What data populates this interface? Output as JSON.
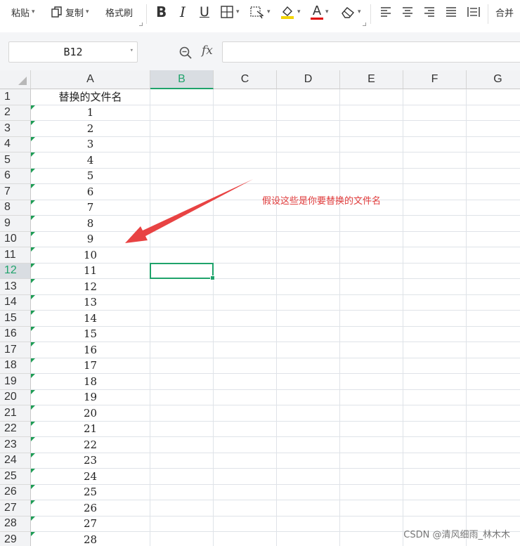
{
  "toolbar": {
    "paste_label": "粘贴",
    "copy_label": "复制",
    "format_painter_label": "格式刷",
    "bold_glyph": "B",
    "italic_glyph": "I",
    "underline_glyph": "U",
    "font_color_glyph": "A",
    "merge_label": "合并"
  },
  "formula_bar": {
    "name_box": "B12",
    "fx_label": "fx",
    "formula": ""
  },
  "sheet": {
    "columns": [
      "A",
      "B",
      "C",
      "D",
      "E",
      "F",
      "G"
    ],
    "rows": [
      "1",
      "2",
      "3",
      "4",
      "5",
      "6",
      "7",
      "8",
      "9",
      "10",
      "11",
      "12",
      "13",
      "14",
      "15",
      "16",
      "17",
      "18",
      "19",
      "20",
      "21",
      "22",
      "23",
      "24",
      "25",
      "26",
      "27",
      "28",
      "29"
    ],
    "column_a_values": [
      "替换的文件名",
      "1",
      "2",
      "3",
      "4",
      "5",
      "6",
      "7",
      "8",
      "9",
      "10",
      "11",
      "12",
      "13",
      "14",
      "15",
      "16",
      "17",
      "18",
      "19",
      "20",
      "21",
      "22",
      "23",
      "24",
      "25",
      "26",
      "27",
      "28"
    ],
    "selected_column": "B",
    "selected_row": "12"
  },
  "annotation": {
    "text": "假设这些是你要替换的文件名",
    "color": "#e03a3a"
  },
  "watermark": "CSDN @清风细雨_林木木",
  "colors": {
    "accent": "#1fa36b",
    "annotation": "#e03a3a",
    "green_triangle": "#1f9d55"
  }
}
